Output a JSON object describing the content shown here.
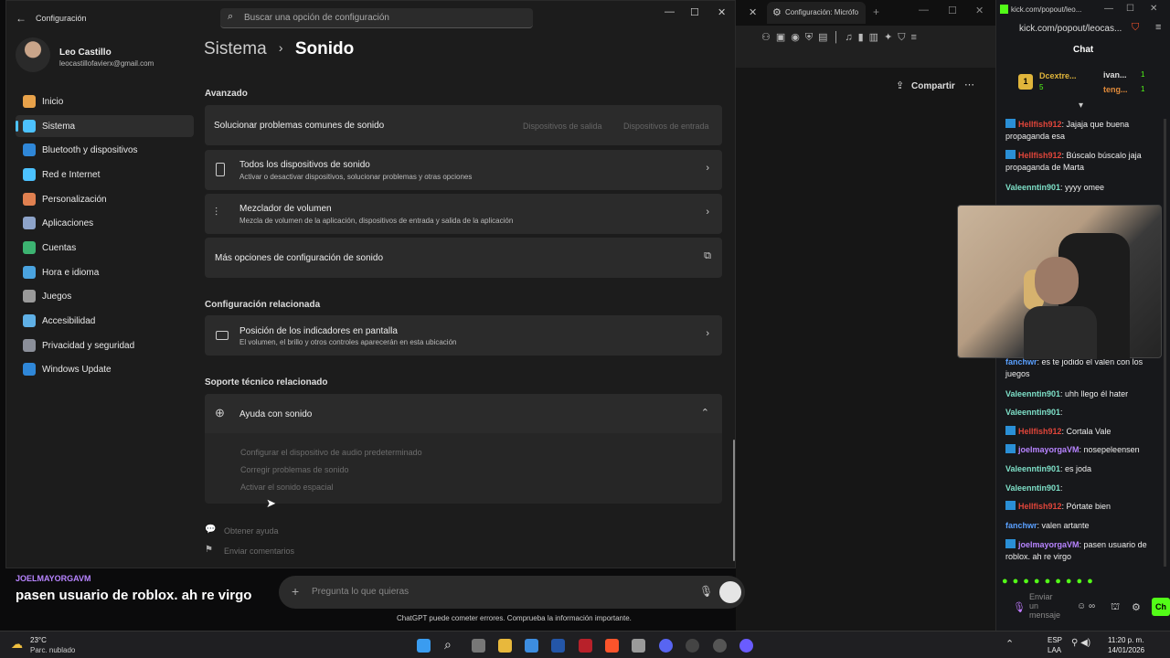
{
  "settings": {
    "app_title": "Configuración",
    "search_placeholder": "Buscar una opción de configuración",
    "user_name": "Leo Castillo",
    "user_email": "leocastillofavierx@gmail.com",
    "breadcrumb_parent": "Sistema",
    "breadcrumb_sep": "›",
    "page_title": "Sonido",
    "nav": [
      "Inicio",
      "Sistema",
      "Bluetooth y dispositivos",
      "Red e Internet",
      "Personalización",
      "Aplicaciones",
      "Cuentas",
      "Hora e idioma",
      "Juegos",
      "Accesibilidad",
      "Privacidad y seguridad",
      "Windows Update"
    ],
    "nav_colors": [
      "#e8a24a",
      "#4cc2ff",
      "#2f87d8",
      "#4cc2ff",
      "#e08050",
      "#8da3c9",
      "#3cb371",
      "#4aa3df",
      "#9a9a9a",
      "#5fb0e6",
      "#8b8f99",
      "#2f87d8"
    ],
    "advanced_heading": "Avanzado",
    "troubleshoot": "Solucionar problemas comunes de sonido",
    "output_devices": "Dispositivos de salida",
    "input_devices": "Dispositivos de entrada",
    "all_devices_title": "Todos los dispositivos de sonido",
    "all_devices_sub": "Activar o desactivar dispositivos, solucionar problemas y otras opciones",
    "mixer_title": "Mezclador de volumen",
    "mixer_sub": "Mezcla de volumen de la aplicación, dispositivos de entrada y salida de la aplicación",
    "more_options": "Más opciones de configuración de sonido",
    "related_heading": "Configuración relacionada",
    "indicator_title": "Posición de los indicadores en pantalla",
    "indicator_sub": "El volumen, el brillo y otros controles aparecerán en esta ubicación",
    "support_heading": "Soporte técnico relacionado",
    "help_title": "Ayuda con sonido",
    "help_links": [
      "Configurar el dispositivo de audio predeterminado",
      "Corregir problemas de sonido",
      "Activar el sonido espacial"
    ],
    "get_help": "Obtener ayuda",
    "feedback": "Enviar comentarios"
  },
  "browser": {
    "tab_title": "Configuración: Micrófo",
    "share_label": "Compartir",
    "ask_placeholder": "Pregunta lo que quieras",
    "disclaimer": "ChatGPT puede cometer errores. Comprueba la información importante."
  },
  "overlay": {
    "user": "JOELMAYORGAVM",
    "text": "pasen usuario de roblox. ah re virgo"
  },
  "chat": {
    "url_title": "kick.com/popout/leo...",
    "url": "kick.com/popout/leocas...",
    "header": "Chat",
    "leader1": "Dcextre...",
    "leader1_count": "5",
    "leader2": "ivan...",
    "leader2_count": "1",
    "leader3": "teng...",
    "leader3_count": "1",
    "rank": "1",
    "send_placeholder": "Enviar un mensaje",
    "send_label": "Ch",
    "messages": [
      {
        "user": "Hellfish912",
        "color": "#e0453a",
        "text": ": Jajaja que buena propaganda esa",
        "badge": true
      },
      {
        "user": "Hellfish912",
        "color": "#e0453a",
        "text": ": Búscalo búscalo jaja propaganda de Marta",
        "badge": true
      },
      {
        "user": "Valeenntin901",
        "color": "#7ee0c8",
        "text": ": yyyy omee",
        "badge": false
      },
      {
        "user": "fanchwr",
        "color": "#5aa0ff",
        "text": ": es te jodido el valen con los juegos",
        "badge": false
      },
      {
        "user": "Valeenntin901",
        "color": "#7ee0c8",
        "text": ": uhh llego él hater",
        "badge": false
      },
      {
        "user": "Valeenntin901",
        "color": "#7ee0c8",
        "text": ":",
        "badge": false
      },
      {
        "user": "Hellfish912",
        "color": "#e0453a",
        "text": ": Cortala Vale",
        "badge": true
      },
      {
        "user": "joelmayorgaVM",
        "color": "#b784ff",
        "text": ": nosepeleensen",
        "badge": true
      },
      {
        "user": "Valeenntin901",
        "color": "#7ee0c8",
        "text": ": es joda",
        "badge": false
      },
      {
        "user": "Valeenntin901",
        "color": "#7ee0c8",
        "text": ":",
        "badge": false
      },
      {
        "user": "Hellfish912",
        "color": "#e0453a",
        "text": ": Pórtate bien",
        "badge": true
      },
      {
        "user": "fanchwr",
        "color": "#5aa0ff",
        "text": ": valen artante",
        "badge": false
      },
      {
        "user": "joelmayorgaVM",
        "color": "#b784ff",
        "text": ": pasen usuario de roblox. ah re virgo",
        "badge": true
      }
    ]
  },
  "taskbar": {
    "temp": "23°C",
    "weather": "Parc. nublado",
    "lang1": "ESP",
    "lang2": "LAA",
    "time": "11:20 p. m.",
    "date": "14/01/2026"
  }
}
